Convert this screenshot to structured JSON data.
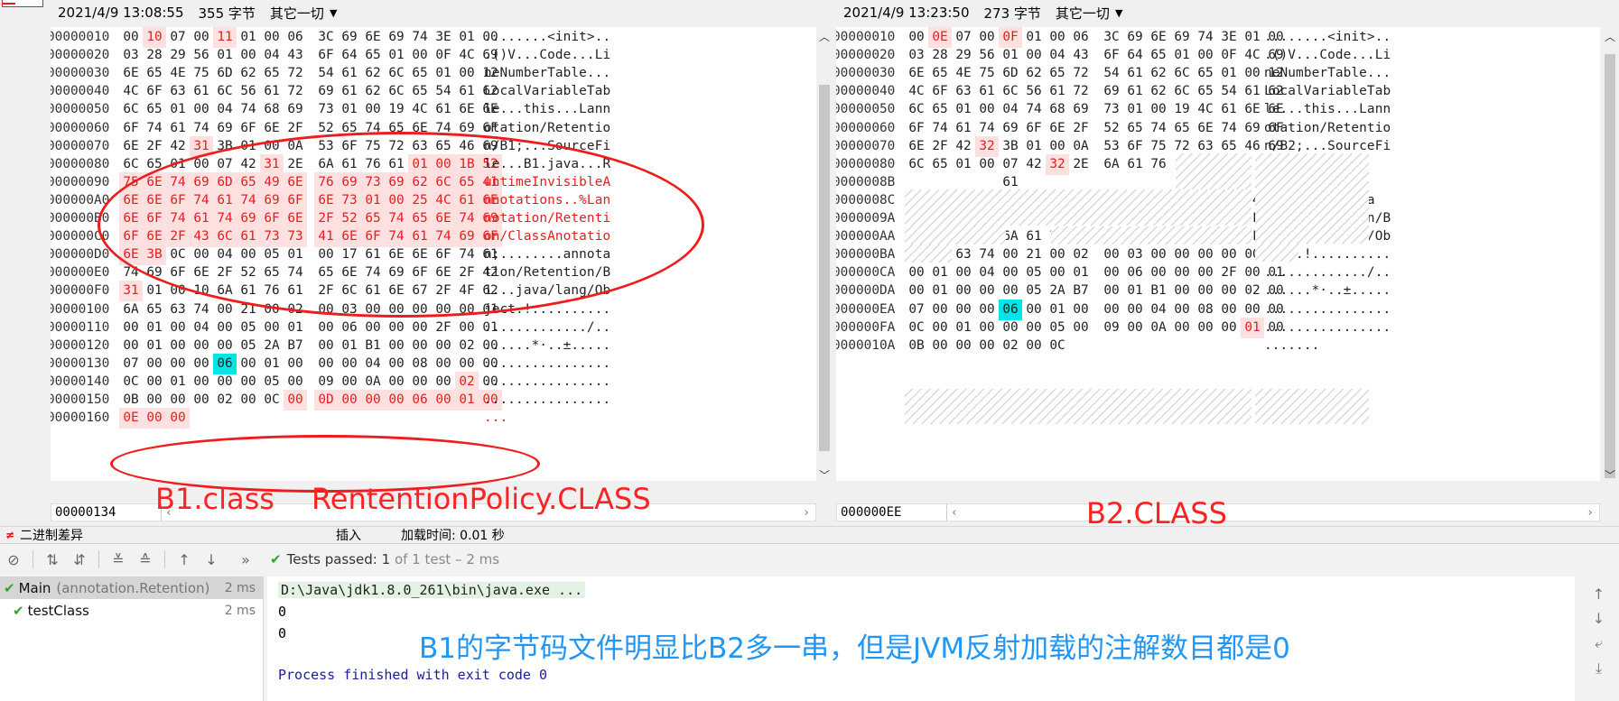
{
  "left_pane": {
    "timestamp": "2021/4/9 13:08:55",
    "size": "355 字节",
    "mode": "其它一切",
    "offset_readout": "00000134",
    "annotation": "B1.class",
    "annotation2": "RententionPolicy.CLASS",
    "rows": [
      {
        "off": "00000010",
        "bytes": [
          "00",
          "10",
          "07",
          "00",
          "11",
          "01",
          "00",
          "06",
          "3C",
          "69",
          "6E",
          "69",
          "74",
          "3E",
          "01",
          "00"
        ],
        "ascii": "........<init>.."
      },
      {
        "off": "00000020",
        "bytes": [
          "03",
          "28",
          "29",
          "56",
          "01",
          "00",
          "04",
          "43",
          "6F",
          "64",
          "65",
          "01",
          "00",
          "0F",
          "4C",
          "69"
        ],
        "ascii": ".()V...Code...Li"
      },
      {
        "off": "00000030",
        "bytes": [
          "6E",
          "65",
          "4E",
          "75",
          "6D",
          "62",
          "65",
          "72",
          "54",
          "61",
          "62",
          "6C",
          "65",
          "01",
          "00",
          "12"
        ],
        "ascii": "neNumberTable..."
      },
      {
        "off": "00000040",
        "bytes": [
          "4C",
          "6F",
          "63",
          "61",
          "6C",
          "56",
          "61",
          "72",
          "69",
          "61",
          "62",
          "6C",
          "65",
          "54",
          "61",
          "62"
        ],
        "ascii": "LocalVariableTab"
      },
      {
        "off": "00000050",
        "bytes": [
          "6C",
          "65",
          "01",
          "00",
          "04",
          "74",
          "68",
          "69",
          "73",
          "01",
          "00",
          "19",
          "4C",
          "61",
          "6E",
          "6E"
        ],
        "ascii": "le...this...Lann"
      },
      {
        "off": "00000060",
        "bytes": [
          "6F",
          "74",
          "61",
          "74",
          "69",
          "6F",
          "6E",
          "2F",
          "52",
          "65",
          "74",
          "65",
          "6E",
          "74",
          "69",
          "6F"
        ],
        "ascii": "otation/Retentio"
      },
      {
        "off": "00000070",
        "bytes": [
          "6E",
          "2F",
          "42",
          "31",
          "3B",
          "01",
          "00",
          "0A",
          "53",
          "6F",
          "75",
          "72",
          "63",
          "65",
          "46",
          "69"
        ],
        "ascii": "n/B1;...SourceFi"
      },
      {
        "off": "00000080",
        "bytes": [
          "6C",
          "65",
          "01",
          "00",
          "07",
          "42",
          "31",
          "2E",
          "6A",
          "61",
          "76",
          "61",
          "01",
          "00",
          "1B",
          "52"
        ],
        "ascii": "le...B1.java...R"
      },
      {
        "off": "00000090",
        "bytes": [
          "75",
          "6E",
          "74",
          "69",
          "6D",
          "65",
          "49",
          "6E",
          "76",
          "69",
          "73",
          "69",
          "62",
          "6C",
          "65",
          "41"
        ],
        "ascii": "untimeInvisibleA"
      },
      {
        "off": "000000A0",
        "bytes": [
          "6E",
          "6E",
          "6F",
          "74",
          "61",
          "74",
          "69",
          "6F",
          "6E",
          "73",
          "01",
          "00",
          "25",
          "4C",
          "61",
          "6E"
        ],
        "ascii": "nnotations..%Lan"
      },
      {
        "off": "000000B0",
        "bytes": [
          "6E",
          "6F",
          "74",
          "61",
          "74",
          "69",
          "6F",
          "6E",
          "2F",
          "52",
          "65",
          "74",
          "65",
          "6E",
          "74",
          "69"
        ],
        "ascii": "notation/Retenti"
      },
      {
        "off": "000000C0",
        "bytes": [
          "6F",
          "6E",
          "2F",
          "43",
          "6C",
          "61",
          "73",
          "73",
          "41",
          "6E",
          "6F",
          "74",
          "61",
          "74",
          "69",
          "6F"
        ],
        "ascii": "on/ClassAnotatio"
      },
      {
        "off": "000000D0",
        "bytes": [
          "6E",
          "3B",
          "0C",
          "00",
          "04",
          "00",
          "05",
          "01",
          "00",
          "17",
          "61",
          "6E",
          "6E",
          "6F",
          "74",
          "61"
        ],
        "ascii": "n;........annota"
      },
      {
        "off": "000000E0",
        "bytes": [
          "74",
          "69",
          "6F",
          "6E",
          "2F",
          "52",
          "65",
          "74",
          "65",
          "6E",
          "74",
          "69",
          "6F",
          "6E",
          "2F",
          "42"
        ],
        "ascii": "tion/Retention/B"
      },
      {
        "off": "000000F0",
        "bytes": [
          "31",
          "01",
          "00",
          "10",
          "6A",
          "61",
          "76",
          "61",
          "2F",
          "6C",
          "61",
          "6E",
          "67",
          "2F",
          "4F",
          "62"
        ],
        "ascii": "1...java/lang/Ob"
      },
      {
        "off": "00000100",
        "bytes": [
          "6A",
          "65",
          "63",
          "74",
          "00",
          "21",
          "00",
          "02",
          "00",
          "03",
          "00",
          "00",
          "00",
          "00",
          "00",
          "01"
        ],
        "ascii": "ject.!.........."
      },
      {
        "off": "00000110",
        "bytes": [
          "00",
          "01",
          "00",
          "04",
          "00",
          "05",
          "00",
          "01",
          "00",
          "06",
          "00",
          "00",
          "00",
          "2F",
          "00",
          "01"
        ],
        "ascii": "............./.."
      },
      {
        "off": "00000120",
        "bytes": [
          "00",
          "01",
          "00",
          "00",
          "00",
          "05",
          "2A",
          "B7",
          "00",
          "01",
          "B1",
          "00",
          "00",
          "00",
          "02",
          "00"
        ],
        "ascii": "......*·..±....."
      },
      {
        "off": "00000130",
        "bytes": [
          "07",
          "00",
          "00",
          "00",
          "06",
          "00",
          "01",
          "00",
          "00",
          "00",
          "04",
          "00",
          "08",
          "00",
          "00",
          "00"
        ],
        "ascii": "................"
      },
      {
        "off": "00000140",
        "bytes": [
          "0C",
          "00",
          "01",
          "00",
          "00",
          "00",
          "05",
          "00",
          "09",
          "00",
          "0A",
          "00",
          "00",
          "00",
          "02",
          "00"
        ],
        "ascii": "................"
      },
      {
        "off": "00000150",
        "bytes": [
          "0B",
          "00",
          "00",
          "00",
          "02",
          "00",
          "0C",
          "00",
          "0D",
          "00",
          "00",
          "00",
          "06",
          "00",
          "01",
          "00"
        ],
        "ascii": "................"
      },
      {
        "off": "00000160",
        "bytes": [
          "0E",
          "00",
          "00"
        ],
        "ascii": "..."
      }
    ]
  },
  "right_pane": {
    "timestamp": "2021/4/9 13:23:50",
    "size": "273 字节",
    "mode": "其它一切",
    "offset_readout": "000000EE",
    "annotation": "B2.CLASS",
    "rows": [
      {
        "off": "00000010",
        "bytes": [
          "00",
          "0E",
          "07",
          "00",
          "0F",
          "01",
          "00",
          "06",
          "3C",
          "69",
          "6E",
          "69",
          "74",
          "3E",
          "01",
          "00"
        ],
        "ascii": "........<init>.."
      },
      {
        "off": "00000020",
        "bytes": [
          "03",
          "28",
          "29",
          "56",
          "01",
          "00",
          "04",
          "43",
          "6F",
          "64",
          "65",
          "01",
          "00",
          "0F",
          "4C",
          "69"
        ],
        "ascii": ".()V...Code...Li"
      },
      {
        "off": "00000030",
        "bytes": [
          "6E",
          "65",
          "4E",
          "75",
          "6D",
          "62",
          "65",
          "72",
          "54",
          "61",
          "62",
          "6C",
          "65",
          "01",
          "00",
          "12"
        ],
        "ascii": "neNumberTable..."
      },
      {
        "off": "00000040",
        "bytes": [
          "4C",
          "6F",
          "63",
          "61",
          "6C",
          "56",
          "61",
          "72",
          "69",
          "61",
          "62",
          "6C",
          "65",
          "54",
          "61",
          "62"
        ],
        "ascii": "LocalVariableTab"
      },
      {
        "off": "00000050",
        "bytes": [
          "6C",
          "65",
          "01",
          "00",
          "04",
          "74",
          "68",
          "69",
          "73",
          "01",
          "00",
          "19",
          "4C",
          "61",
          "6E",
          "6E"
        ],
        "ascii": "le...this...Lann"
      },
      {
        "off": "00000060",
        "bytes": [
          "6F",
          "74",
          "61",
          "74",
          "69",
          "6F",
          "6E",
          "2F",
          "52",
          "65",
          "74",
          "65",
          "6E",
          "74",
          "69",
          "6F"
        ],
        "ascii": "otation/Retentio"
      },
      {
        "off": "00000070",
        "bytes": [
          "6E",
          "2F",
          "42",
          "32",
          "3B",
          "01",
          "00",
          "0A",
          "53",
          "6F",
          "75",
          "72",
          "63",
          "65",
          "46",
          "69"
        ],
        "ascii": "n/B2;...SourceFi"
      },
      {
        "off": "00000080",
        "bytes": [
          "6C",
          "65",
          "01",
          "00",
          "07",
          "42",
          "32",
          "2E",
          "6A",
          "61",
          "76"
        ],
        "ascii": "le...B2.jav"
      },
      {
        "off": "0000008B",
        "bytes": [
          "",
          "",
          "",
          "",
          "61"
        ],
        "ascii": "    a"
      },
      {
        "off": "0000008C",
        "bytes": [
          "",
          "",
          "0C",
          "00",
          "04",
          "00",
          "05",
          "01",
          "00",
          "17",
          "61",
          "6E",
          "6E",
          "6F",
          "74",
          "61"
        ],
        "ascii": "  ........annota"
      },
      {
        "off": "0000009A",
        "bytes": [
          "74",
          "69",
          "6F",
          "6E",
          "2F",
          "52",
          "65",
          "74",
          "65",
          "6E",
          "74",
          "69",
          "6F",
          "6E",
          "2F",
          "42"
        ],
        "ascii": "tion/Retention/B"
      },
      {
        "off": "000000AA",
        "bytes": [
          "32",
          "01",
          "00",
          "10",
          "6A",
          "61",
          "76",
          "61",
          "2F",
          "6C",
          "61",
          "6E",
          "67",
          "2F",
          "4F",
          "62"
        ],
        "ascii": "2...java/lang/Ob"
      },
      {
        "off": "000000BA",
        "bytes": [
          "6A",
          "65",
          "63",
          "74",
          "00",
          "21",
          "00",
          "02",
          "00",
          "03",
          "00",
          "00",
          "00",
          "00",
          "00",
          "01"
        ],
        "ascii": "ject.!.........."
      },
      {
        "off": "000000CA",
        "bytes": [
          "00",
          "01",
          "00",
          "04",
          "00",
          "05",
          "00",
          "01",
          "00",
          "06",
          "00",
          "00",
          "00",
          "2F",
          "00",
          "01"
        ],
        "ascii": "............./.."
      },
      {
        "off": "000000DA",
        "bytes": [
          "00",
          "01",
          "00",
          "00",
          "00",
          "05",
          "2A",
          "B7",
          "00",
          "01",
          "B1",
          "00",
          "00",
          "00",
          "02",
          "00"
        ],
        "ascii": "......*·..±....."
      },
      {
        "off": "000000EA",
        "bytes": [
          "07",
          "00",
          "00",
          "00",
          "06",
          "00",
          "01",
          "00",
          "00",
          "00",
          "04",
          "00",
          "08",
          "00",
          "00",
          "00"
        ],
        "ascii": "................"
      },
      {
        "off": "000000FA",
        "bytes": [
          "0C",
          "00",
          "01",
          "00",
          "00",
          "00",
          "05",
          "00",
          "09",
          "00",
          "0A",
          "00",
          "00",
          "00",
          "01",
          "00"
        ],
        "ascii": "................"
      },
      {
        "off": "0000010A",
        "bytes": [
          "0B",
          "00",
          "00",
          "00",
          "02",
          "00",
          "0C"
        ],
        "ascii": "......."
      }
    ]
  },
  "statusbar": {
    "icon": "≠",
    "title": "二进制差异",
    "mode": "插入",
    "load_time": "加载时间:  0.01 秒"
  },
  "run": {
    "status_prefix": "Tests passed: ",
    "passed": "1",
    "status_suffix": " of 1 test – 2 ms",
    "tree": [
      {
        "name": "Main",
        "pkg": "(annotation.Retention)",
        "dur": "2 ms"
      },
      {
        "name": "testClass",
        "pkg": "",
        "dur": "2 ms"
      }
    ],
    "console": {
      "cmd": "D:\\Java\\jdk1.8.0_261\\bin\\java.exe ...",
      "out1": "0",
      "out2": "0",
      "finish": "Process finished with exit code 0"
    },
    "annotation": "B1的字节码文件明显比B2多一串，但是JVM反射加载的注解数目都是0"
  },
  "colors": {
    "diff_highlight_bg": "#ffe0e0",
    "diff_text": "#e02020",
    "cursor_cyan": "#00e5e5",
    "annotation_red": "#ff2222",
    "annotation_blue": "#2196f3",
    "pass_green": "#35a035"
  }
}
